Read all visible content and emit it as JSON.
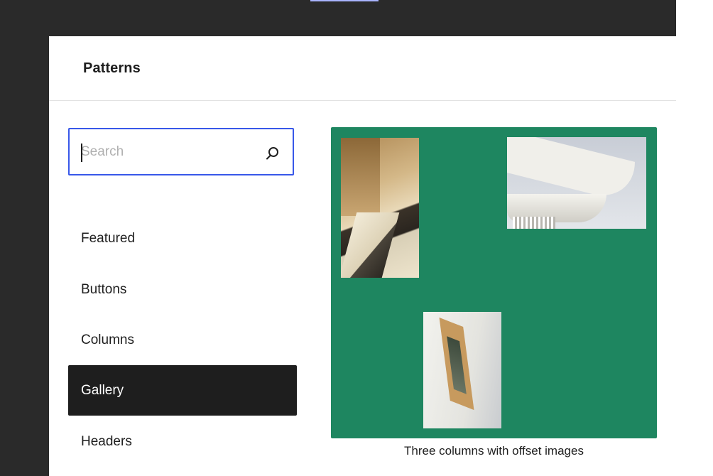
{
  "modal": {
    "title": "Patterns"
  },
  "search": {
    "placeholder": "Search",
    "value": "",
    "icon": "search-icon"
  },
  "categories": [
    {
      "label": "Featured",
      "active": false
    },
    {
      "label": "Buttons",
      "active": false
    },
    {
      "label": "Columns",
      "active": false
    },
    {
      "label": "Gallery",
      "active": true
    },
    {
      "label": "Headers",
      "active": false
    }
  ],
  "pattern_preview": {
    "caption": "Three columns with offset images",
    "background_color": "#1e8660"
  },
  "colors": {
    "accent": "#3858e9",
    "active_item_bg": "#1e1e1e",
    "backdrop": "#2a2a2a"
  }
}
